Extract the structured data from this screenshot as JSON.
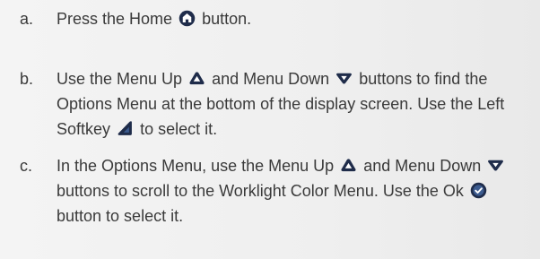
{
  "steps": [
    {
      "letter": "a.",
      "parts": {
        "t1": "Press the Home",
        "t2": "button."
      }
    },
    {
      "letter": "b.",
      "parts": {
        "t1": "Use the Menu Up",
        "t2": "and Menu Down",
        "t3": "buttons to find the Options Menu at the bottom of the display screen. Use the Left Softkey",
        "t4": "to select it."
      }
    },
    {
      "letter": "c.",
      "parts": {
        "t1": "In the Options Menu, use the Menu Up",
        "t2": "and Menu Down",
        "t3": "buttons to scroll to the Worklight Color Menu. Use the Ok",
        "t4": "button to select it."
      }
    }
  ],
  "icons": {
    "home": "home-button-icon",
    "menu_up": "menu-up-button-icon",
    "menu_down": "menu-down-button-icon",
    "left_softkey": "left-softkey-icon",
    "ok": "ok-button-icon"
  },
  "colors": {
    "text": "#3a3a3a",
    "icon": "#1f2c4a",
    "icon_highlight": "#3c5b8f"
  }
}
